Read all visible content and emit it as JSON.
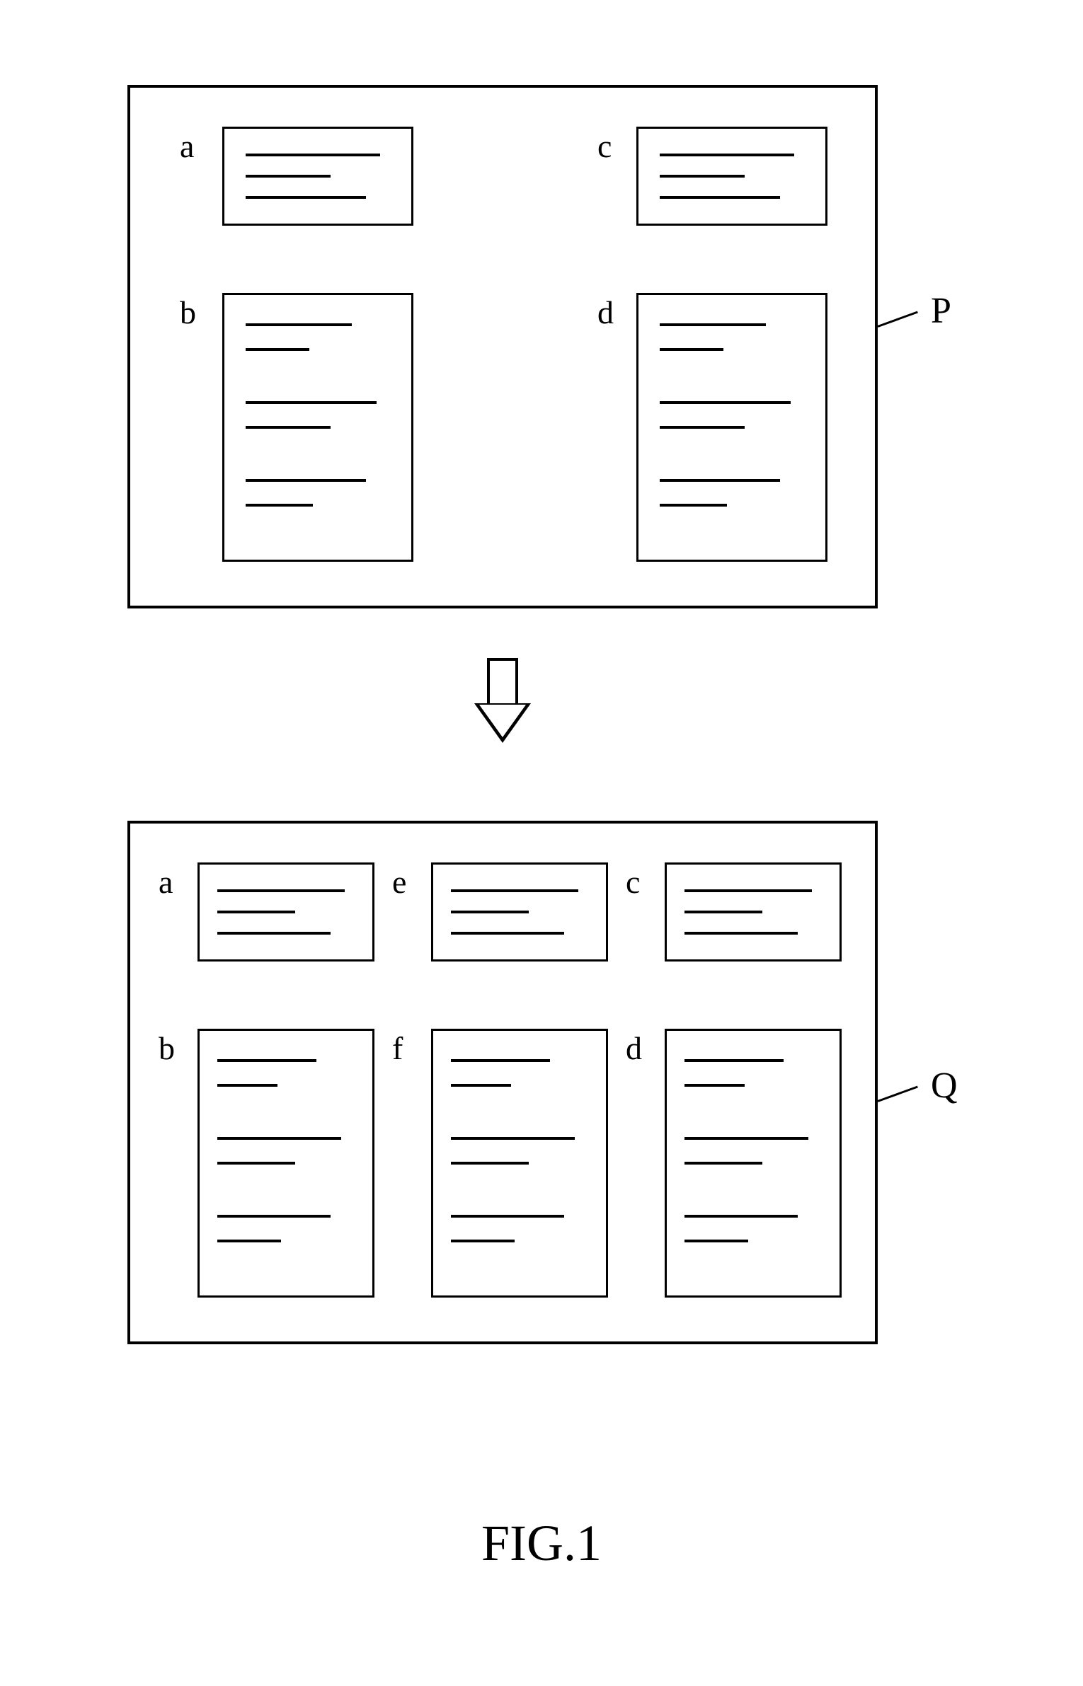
{
  "figure_label": "FIG.1",
  "panel_P": {
    "external_label": "P",
    "cards": {
      "a": {
        "label": "a"
      },
      "b": {
        "label": "b"
      },
      "c": {
        "label": "c"
      },
      "d": {
        "label": "d"
      }
    }
  },
  "panel_Q": {
    "external_label": "Q",
    "cards": {
      "a": {
        "label": "a"
      },
      "b": {
        "label": "b"
      },
      "c": {
        "label": "c"
      },
      "d": {
        "label": "d"
      },
      "e": {
        "label": "e"
      },
      "f": {
        "label": "f"
      }
    }
  }
}
